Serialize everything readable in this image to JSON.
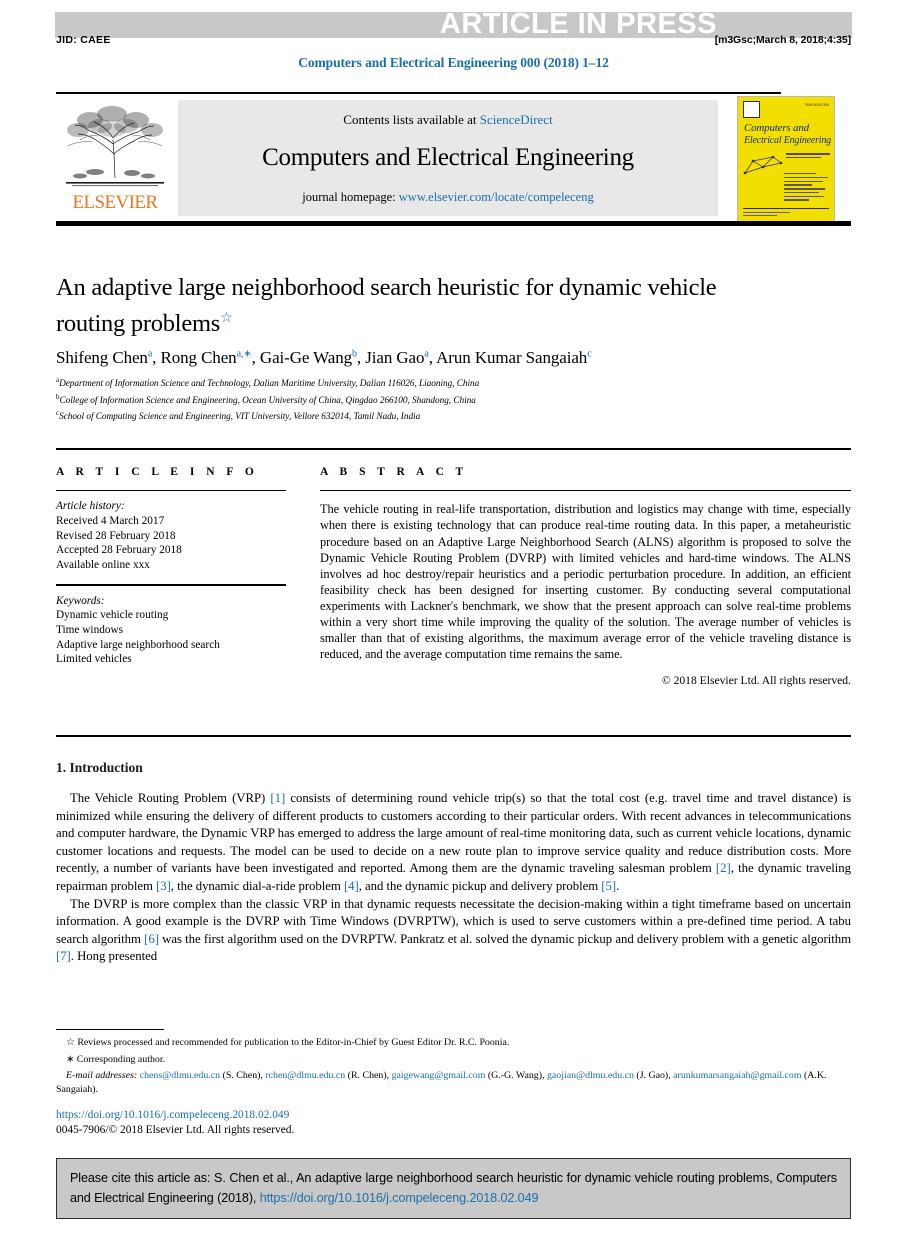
{
  "banner": {
    "text": "ARTICLE IN PRESS",
    "jid": "JID: CAEE",
    "stamp": "[m3Gsc;March 8, 2018;4:35]"
  },
  "running_head": "Computers and Electrical Engineering 000 (2018) 1–12",
  "masthead": {
    "contents_prefix": "Contents lists available at ",
    "contents_link": "ScienceDirect",
    "journal_title": "Computers and Electrical Engineering",
    "homepage_label": "journal homepage: ",
    "homepage_url": "www.elsevier.com/locate/compeleceng",
    "publisher": "ELSEVIER",
    "cover": {
      "title_line1": "Computers and",
      "title_line2": "Electrical Engineering",
      "issn": "ISSN 0045-7906"
    }
  },
  "article": {
    "title": "An adaptive large neighborhood search heuristic for dynamic vehicle routing problems",
    "title_footnote_marker": "☆",
    "authors": [
      {
        "name": "Shifeng Chen",
        "sup": "a"
      },
      {
        "name": "Rong Chen",
        "sup": "a,∗"
      },
      {
        "name": "Gai-Ge Wang",
        "sup": "b"
      },
      {
        "name": "Jian Gao",
        "sup": "a"
      },
      {
        "name": "Arun Kumar Sangaiah",
        "sup": "c"
      }
    ],
    "affiliations": [
      {
        "marker": "a",
        "text": "Department of Information Science and Technology, Dalian Maritime University, Dalian 116026, Liaoning, China"
      },
      {
        "marker": "b",
        "text": "College of Information Science and Engineering, Ocean University of China, Qingdao 266100, Shandong, China"
      },
      {
        "marker": "c",
        "text": "School of Computing Science and Engineering, VIT University, Vellore 632014, Tamil Nadu, India"
      }
    ]
  },
  "article_info": {
    "heading": "A R T I C L E   I N F O",
    "history_label": "Article history:",
    "history": [
      "Received 4 March 2017",
      "Revised 28 February 2018",
      "Accepted 28 February 2018",
      "Available online xxx"
    ],
    "keywords_label": "Keywords:",
    "keywords": [
      "Dynamic vehicle routing",
      "Time windows",
      "Adaptive large neighborhood search",
      "Limited vehicles"
    ]
  },
  "abstract": {
    "heading": "A B S T R A C T",
    "text": "The vehicle routing in real-life transportation, distribution and logistics may change with time, especially when there is existing technology that can produce real-time routing data. In this paper, a metaheuristic procedure based on an Adaptive Large Neighborhood Search (ALNS) algorithm is proposed to solve the Dynamic Vehicle Routing Problem (DVRP) with limited vehicles and hard-time windows. The ALNS involves ad hoc destroy/repair heuristics and a periodic perturbation procedure. In addition, an efficient feasibility check has been designed for inserting customer. By conducting several computational experiments with Lackner's benchmark, we show that the present approach can solve real-time problems within a very short time while improving the quality of the solution. The average number of vehicles is smaller than that of existing algorithms, the maximum average error of the vehicle traveling distance is reduced, and the average computation time remains the same.",
    "copyright": "© 2018 Elsevier Ltd. All rights reserved."
  },
  "body": {
    "section_title": "1. Introduction",
    "paragraph1_part1": "The Vehicle Routing Problem (VRP) ",
    "paragraph1_ref1": "[1]",
    "paragraph1_part2": " consists of determining round vehicle trip(s) so that the total cost (e.g. travel time and travel distance) is minimized while ensuring the delivery of different products to customers according to their particular orders. With recent advances in telecommunications and computer hardware, the Dynamic VRP has emerged to address the large amount of real-time monitoring data, such as current vehicle locations, dynamic customer locations and requests. The model can be used to decide on a new route plan to improve service quality and reduce distribution costs. More recently, a number of variants have been investigated and reported. Among them are the dynamic traveling salesman problem ",
    "paragraph1_ref2": "[2]",
    "paragraph1_part3": ", the dynamic traveling repairman problem ",
    "paragraph1_ref3": "[3]",
    "paragraph1_part4": ", the dynamic dial-a-ride problem ",
    "paragraph1_ref4": "[4]",
    "paragraph1_part5": ", and the dynamic pickup and delivery problem ",
    "paragraph1_ref5": "[5]",
    "paragraph1_part6": ".",
    "paragraph2_part1": "The DVRP is more complex than the classic VRP in that dynamic requests necessitate the decision-making within a tight timeframe based on uncertain information. A good example is the DVRP with Time Windows (DVRPTW), which is used to serve customers within a pre-defined time period. A tabu search algorithm ",
    "paragraph2_ref1": "[6]",
    "paragraph2_part2": " was the first algorithm used on the DVRPTW. Pankratz et al. solved the dynamic pickup and delivery problem with a genetic algorithm ",
    "paragraph2_ref2": "[7]",
    "paragraph2_part3": ". Hong presented"
  },
  "footnotes": {
    "star_marker": "☆",
    "star_text": "Reviews processed and recommended for publication to the Editor-in-Chief by Guest Editor Dr. R.C. Poonia.",
    "corresponding_marker": "∗",
    "corresponding_text": "Corresponding author.",
    "email_label": "E-mail addresses:",
    "emails": [
      {
        "address": "chens@dlmu.edu.cn",
        "person": "(S. Chen)"
      },
      {
        "address": "rchen@dlmu.edu.cn",
        "person": "(R. Chen)"
      },
      {
        "address": "gaigewang@gmail.com",
        "person": "(G.-G. Wang)"
      },
      {
        "address": "gaojian@dlmu.edu.cn",
        "person": "(J. Gao)"
      },
      {
        "address": "arunkumarsangaiah@gmail.com",
        "person": "(A.K. Sangaiah)"
      }
    ],
    "doi": "https://doi.org/10.1016/j.compeleceng.2018.02.049",
    "issn_line": "0045-7906/© 2018 Elsevier Ltd. All rights reserved."
  },
  "cite_box": {
    "text_part1": "Please cite this article as: S. Chen et al., An adaptive large neighborhood search heuristic for dynamic vehicle routing problems, Computers and Electrical Engineering (2018), ",
    "doi": "https://doi.org/10.1016/j.compeleceng.2018.02.049"
  },
  "colors": {
    "link_blue": "#1a6fa8",
    "elsevier_orange": "#E87722",
    "banner_gray": "#c8c8c8",
    "cover_yellow": "#f2df00",
    "cover_navy": "#15306b"
  }
}
